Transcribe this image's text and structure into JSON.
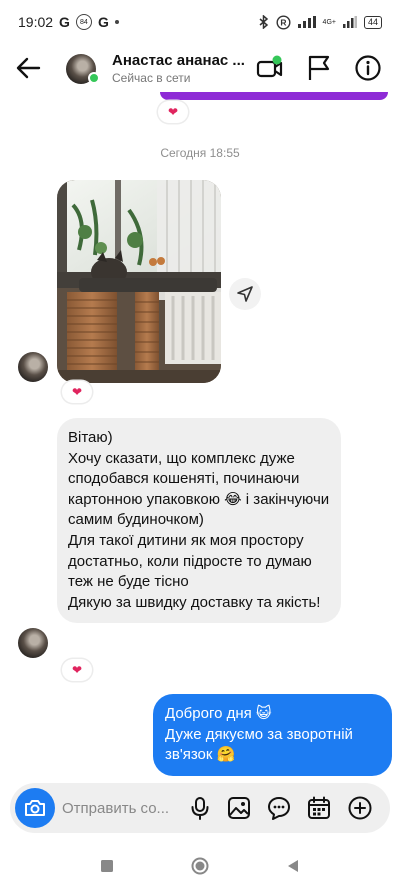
{
  "status_bar": {
    "time": "19:02",
    "g1": "G",
    "badge": "84",
    "g2": "G",
    "network": "4G+",
    "battery": "44",
    "icons": [
      "bluetooth-icon",
      "registered-icon",
      "signal-icon",
      "battery-icon"
    ]
  },
  "header": {
    "contact_name": "Анастас ананас ...",
    "contact_status": "Сейчас в сети",
    "icons": [
      "back-arrow-icon",
      "video-call-icon",
      "flag-icon",
      "info-icon"
    ]
  },
  "chat": {
    "reaction_heart": "❤",
    "date_separator": "Сегодня 18:55",
    "incoming_message": "Вітаю)\nХочу сказати, що комплекс дуже сподобався кошеняті, починаючи картонною упаковкою 😂 і закінчуючи самим будиночком)\nДля такої дитини як моя простору достатньо, коли підросте то думаю теж не буде тісно\nДякую за швидку доставку та якість!",
    "outgoing_message": "Доброго дня 😺\nДуже дякуємо за зворотній зв'язок 🤗",
    "colors": {
      "incoming_bubble": "#efefef",
      "outgoing_bubble": "#1d7cf2",
      "previous_bubble": "#8e2bd6",
      "reaction_heart": "#e0245e"
    }
  },
  "composer": {
    "placeholder": "Отправить со...",
    "icons": [
      "camera-icon",
      "microphone-icon",
      "gallery-icon",
      "sticker-icon",
      "calendar-icon",
      "add-icon"
    ]
  },
  "nav_bar": {
    "icons": [
      "recent-apps-icon",
      "home-icon",
      "back-icon"
    ]
  }
}
